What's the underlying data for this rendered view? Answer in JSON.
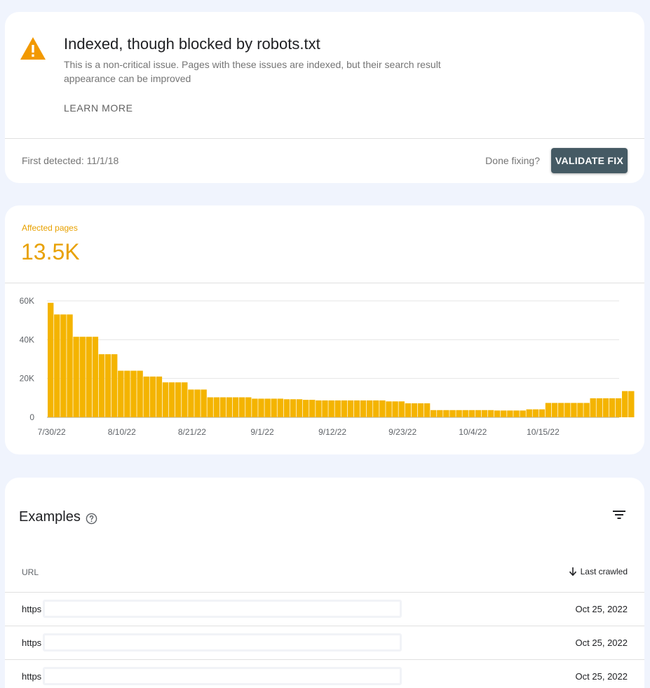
{
  "issue": {
    "title": "Indexed, though blocked by robots.txt",
    "description": "This is a non-critical issue. Pages with these issues are indexed, but their search result appearance can be improved",
    "learn_more": "LEARN MORE",
    "first_detected": "First detected: 11/1/18",
    "done_fixing": "Done fixing?",
    "validate_fix": "VALIDATE FIX",
    "icon": "warning-icon",
    "warning_color": "#f29900"
  },
  "affected": {
    "label": "Affected pages",
    "value": "13.5K",
    "accent_color": "#f4b400"
  },
  "chart_data": {
    "type": "bar",
    "title": "",
    "xlabel": "",
    "ylabel": "",
    "ylim": [
      0,
      60000
    ],
    "y_ticks": [
      "0",
      "20K",
      "40K",
      "60K"
    ],
    "y_tick_values": [
      0,
      20000,
      40000,
      60000
    ],
    "x_tick_labels": [
      "7/30/22",
      "8/10/22",
      "8/21/22",
      "9/1/22",
      "9/12/22",
      "9/23/22",
      "10/4/22",
      "10/15/22"
    ],
    "x_tick_indices": [
      0,
      11,
      22,
      33,
      44,
      55,
      66,
      77
    ],
    "grid": true,
    "color": "#f4b400",
    "values": [
      59000,
      53000,
      53000,
      53000,
      41500,
      41500,
      41500,
      41500,
      32500,
      32500,
      32500,
      24000,
      24000,
      24000,
      24000,
      21000,
      21000,
      21000,
      18000,
      18000,
      18000,
      18000,
      14300,
      14300,
      14300,
      10300,
      10300,
      10300,
      10300,
      10300,
      10300,
      10300,
      9600,
      9600,
      9600,
      9600,
      9600,
      9300,
      9300,
      9300,
      9000,
      9000,
      8700,
      8700,
      8700,
      8700,
      8700,
      8700,
      8700,
      8700,
      8700,
      8700,
      8700,
      8200,
      8200,
      8200,
      7200,
      7200,
      7200,
      7200,
      3700,
      3700,
      3700,
      3700,
      3700,
      3700,
      3700,
      3700,
      3700,
      3700,
      3500,
      3500,
      3500,
      3500,
      3500,
      4100,
      4100,
      4100,
      7400,
      7400,
      7400,
      7400,
      7400,
      7400,
      7400,
      9800,
      9800,
      9800,
      9800,
      9800,
      13500,
      13500
    ]
  },
  "examples": {
    "title": "Examples",
    "col_url": "URL",
    "col_last_crawled": "Last crawled",
    "rows": [
      {
        "url": "https",
        "date": "Oct 25, 2022"
      },
      {
        "url": "https",
        "date": "Oct 25, 2022"
      },
      {
        "url": "https",
        "date": "Oct 25, 2022"
      }
    ]
  }
}
